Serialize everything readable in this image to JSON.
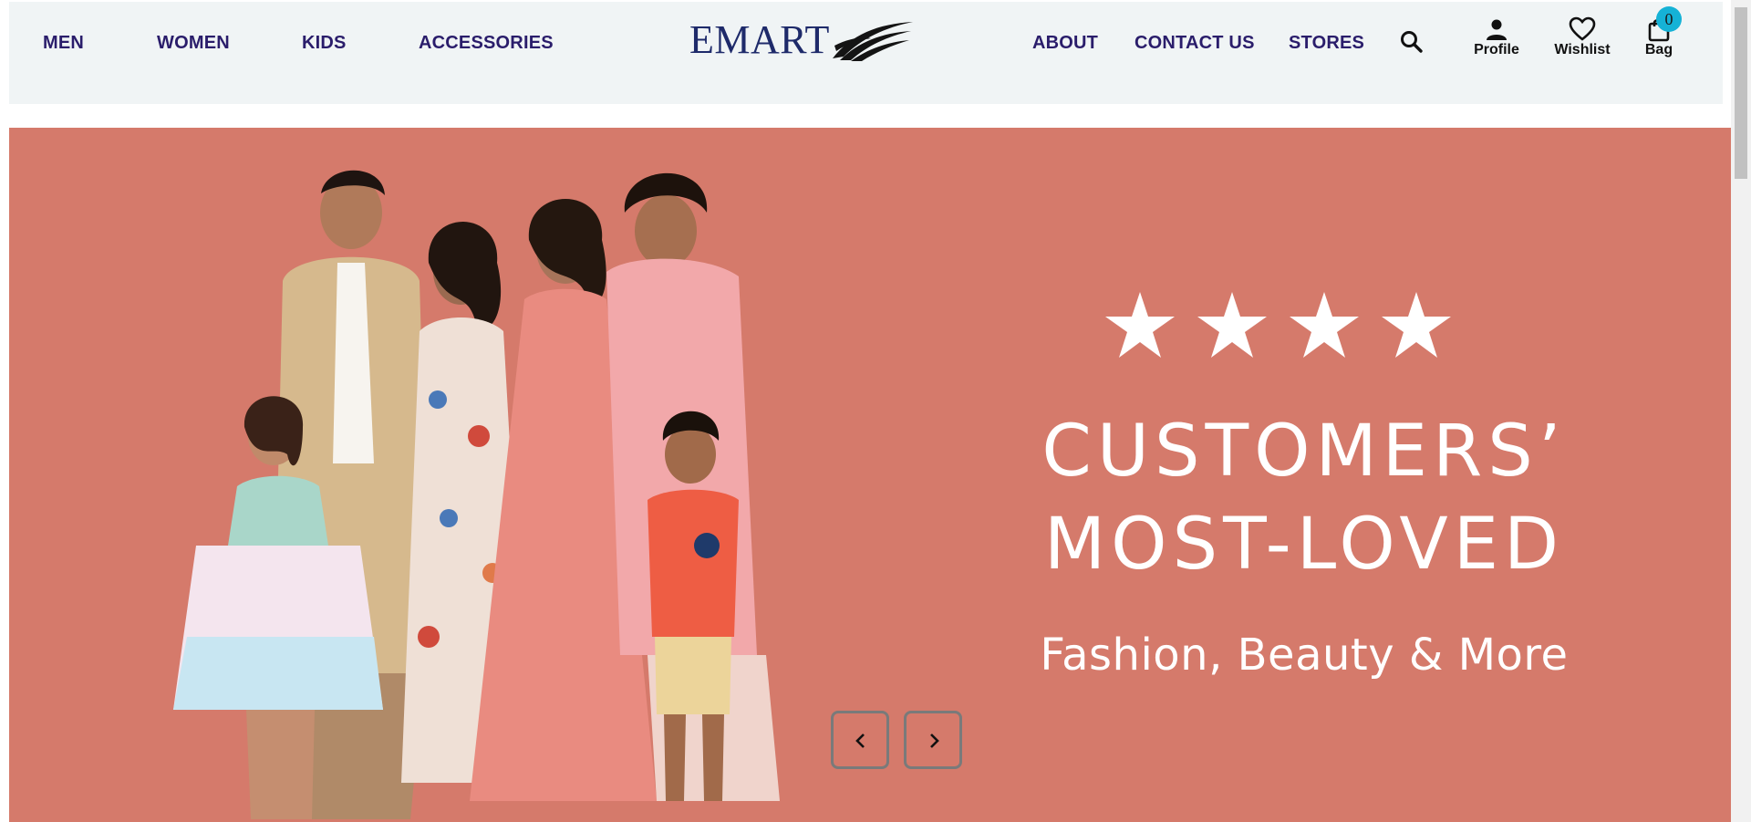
{
  "header": {
    "nav_left": [
      "MEN",
      "WOMEN",
      "KIDS",
      "ACCESSORIES"
    ],
    "logo_text": "EMART",
    "nav_right": [
      "ABOUT",
      "CONTACT US",
      "STORES"
    ],
    "icons": {
      "search": "search-icon",
      "profile_label": "Profile",
      "wishlist_label": "Wishlist",
      "bag_label": "Bag",
      "bag_count": "0"
    }
  },
  "banner": {
    "rating_stars": 4,
    "headline_line1": "CUSTOMERS’",
    "headline_line2": "MOST-LOVED",
    "subline": "Fashion, Beauty & More",
    "prev_icon": "chevron-left-icon",
    "next_icon": "chevron-right-icon"
  },
  "colors": {
    "header_bg": "#f0f4f5",
    "nav_text": "#2a1d6b",
    "logo": "#1e2a6a",
    "banner_bg": "#d57a6b",
    "badge": "#15b2d6"
  }
}
